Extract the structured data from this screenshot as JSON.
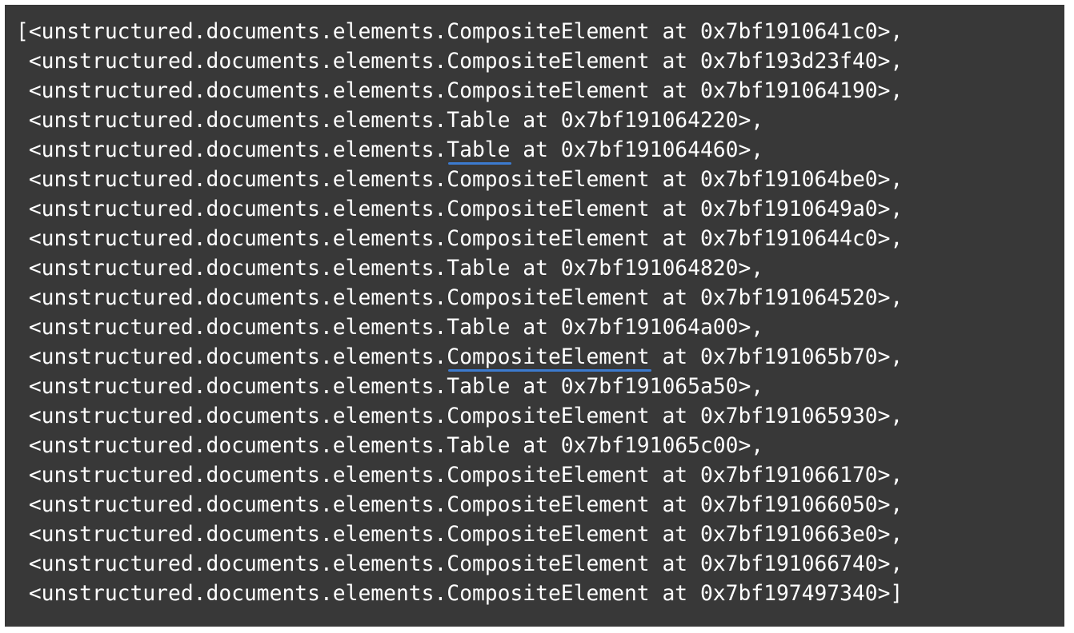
{
  "output": {
    "lines": [
      {
        "prefix": "[<unstructured.documents.elements.",
        "type": "CompositeElement",
        "suffix": " at 0x7bf1910641c0>,",
        "underlined": false
      },
      {
        "prefix": " <unstructured.documents.elements.",
        "type": "CompositeElement",
        "suffix": " at 0x7bf193d23f40>,",
        "underlined": false
      },
      {
        "prefix": " <unstructured.documents.elements.",
        "type": "CompositeElement",
        "suffix": " at 0x7bf191064190>,",
        "underlined": false
      },
      {
        "prefix": " <unstructured.documents.elements.",
        "type": "Table",
        "suffix": " at 0x7bf191064220>,",
        "underlined": false
      },
      {
        "prefix": " <unstructured.documents.elements.",
        "type": "Table",
        "suffix": " at 0x7bf191064460>,",
        "underlined": true
      },
      {
        "prefix": " <unstructured.documents.elements.",
        "type": "CompositeElement",
        "suffix": " at 0x7bf191064be0>,",
        "underlined": false
      },
      {
        "prefix": " <unstructured.documents.elements.",
        "type": "CompositeElement",
        "suffix": " at 0x7bf1910649a0>,",
        "underlined": false
      },
      {
        "prefix": " <unstructured.documents.elements.",
        "type": "CompositeElement",
        "suffix": " at 0x7bf1910644c0>,",
        "underlined": false
      },
      {
        "prefix": " <unstructured.documents.elements.",
        "type": "Table",
        "suffix": " at 0x7bf191064820>,",
        "underlined": false
      },
      {
        "prefix": " <unstructured.documents.elements.",
        "type": "CompositeElement",
        "suffix": " at 0x7bf191064520>,",
        "underlined": false
      },
      {
        "prefix": " <unstructured.documents.elements.",
        "type": "Table",
        "suffix": " at 0x7bf191064a00>,",
        "underlined": false
      },
      {
        "prefix": " <unstructured.documents.elements.",
        "type": "CompositeElement",
        "suffix": " at 0x7bf191065b70>,",
        "underlined": true
      },
      {
        "prefix": " <unstructured.documents.elements.",
        "type": "Table",
        "suffix": " at 0x7bf191065a50>,",
        "underlined": false
      },
      {
        "prefix": " <unstructured.documents.elements.",
        "type": "CompositeElement",
        "suffix": " at 0x7bf191065930>,",
        "underlined": false
      },
      {
        "prefix": " <unstructured.documents.elements.",
        "type": "Table",
        "suffix": " at 0x7bf191065c00>,",
        "underlined": false
      },
      {
        "prefix": " <unstructured.documents.elements.",
        "type": "CompositeElement",
        "suffix": " at 0x7bf191066170>,",
        "underlined": false
      },
      {
        "prefix": " <unstructured.documents.elements.",
        "type": "CompositeElement",
        "suffix": " at 0x7bf191066050>,",
        "underlined": false
      },
      {
        "prefix": " <unstructured.documents.elements.",
        "type": "CompositeElement",
        "suffix": " at 0x7bf1910663e0>,",
        "underlined": false
      },
      {
        "prefix": " <unstructured.documents.elements.",
        "type": "CompositeElement",
        "suffix": " at 0x7bf191066740>,",
        "underlined": false
      },
      {
        "prefix": " <unstructured.documents.elements.",
        "type": "CompositeElement",
        "suffix": " at 0x7bf197497340>]",
        "underlined": false
      }
    ]
  },
  "colors": {
    "panel_background": "#383838",
    "text": "#ffffff",
    "underline_annotation": "#3c7bd0"
  }
}
